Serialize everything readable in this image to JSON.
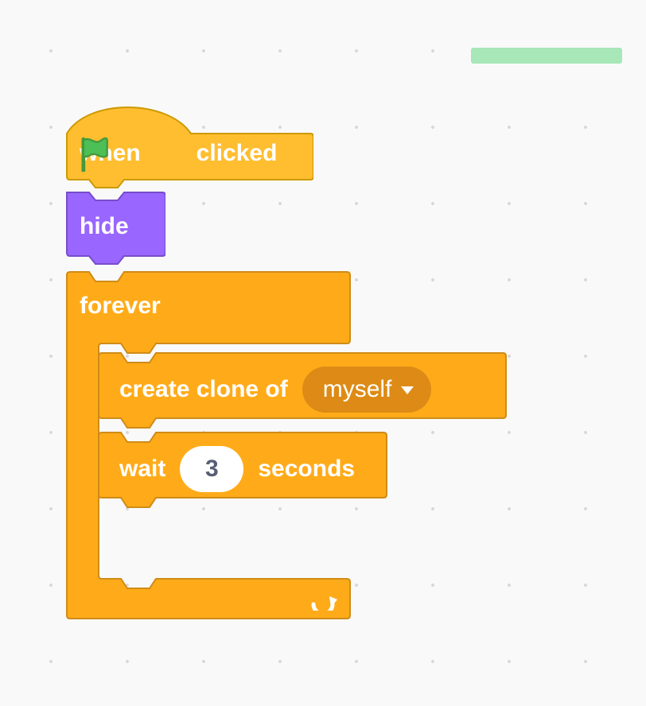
{
  "colors": {
    "events_fill": "#ffbe30",
    "events_stroke": "#cc9900",
    "looks_fill": "#9966ff",
    "looks_stroke": "#774dcb",
    "control_fill": "#ffab19",
    "control_stroke": "#cf8b17",
    "flag_green": "#4cbf56",
    "flag_pole": "#45993d"
  },
  "hat": {
    "prefix": "when",
    "flag_name": "green-flag-icon",
    "suffix": "clicked"
  },
  "hide": {
    "label": "hide"
  },
  "forever": {
    "label": "forever"
  },
  "clone": {
    "label": "create clone of",
    "dropdown_value": "myself"
  },
  "wait": {
    "prefix": "wait",
    "value": "3",
    "suffix": "seconds"
  }
}
